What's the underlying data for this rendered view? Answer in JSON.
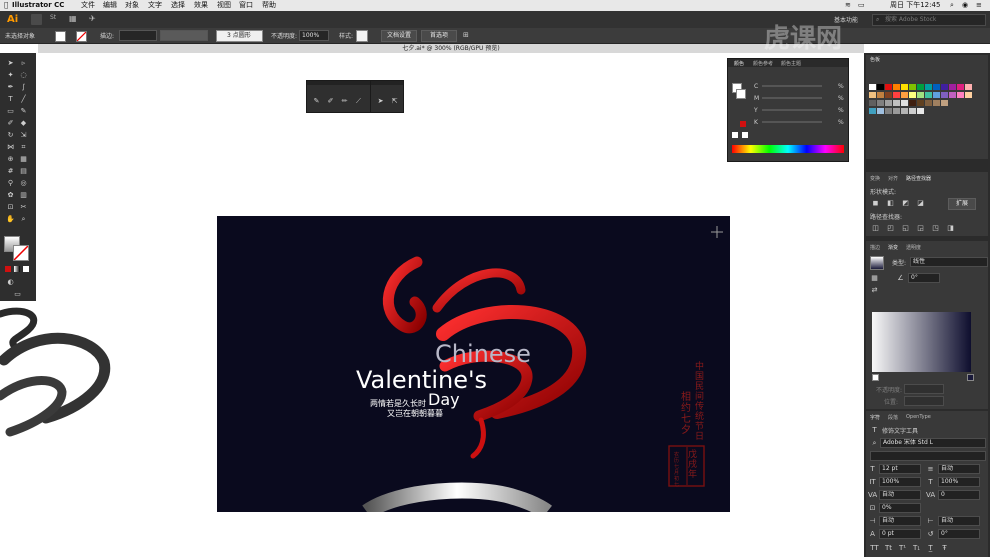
{
  "menubar": {
    "app_name": "Illustrator CC",
    "menus": [
      "文件",
      "编辑",
      "对象",
      "文字",
      "选择",
      "效果",
      "视图",
      "窗口",
      "帮助"
    ],
    "clock": "周日 下午12:45"
  },
  "appbar": {
    "logo": "Ai",
    "br": "Br",
    "st": "St",
    "workspace": "基本功能",
    "search_placeholder": "搜索 Adobe Stock"
  },
  "control_bar": {
    "selection_status": "未选择对象",
    "stroke_label": "描边:",
    "brush_label": "3 点圆形",
    "opacity_label": "不透明度:",
    "opacity_value": "100%",
    "style_label": "样式:",
    "doc_setup": "文档设置",
    "preferences": "首选项"
  },
  "document_tab": {
    "title": "七夕.ai* @ 300% (RGB/GPU 预览)"
  },
  "color_panel": {
    "tabs": [
      "颜色",
      "颜色参考",
      "颜色主题"
    ],
    "channels": [
      "C",
      "M",
      "Y",
      "K"
    ],
    "unit": "%"
  },
  "right_dock": {
    "swatches_tab": "色板",
    "tabs_row1": [
      "变换",
      "对齐",
      "路径查找器"
    ],
    "shape_modes_label": "形状模式:",
    "expand_button": "扩展",
    "pathfinder_label": "路径查找器:",
    "tabs_row2": [
      "描边",
      "渐变",
      "透明度"
    ],
    "type_label": "类型:",
    "type_value": "线性",
    "angle_value": "0°",
    "gradient_opacity_label": "不透明度:",
    "gradient_location_label": "位置:",
    "tabs_row3": [
      "字符",
      "段落",
      "OpenType"
    ],
    "touch_type": "修饰文字工具",
    "font_family": "Adobe 宋体 Std L",
    "font_size": "12 pt",
    "leading": "自动",
    "vscale": "100%",
    "hscale": "100%",
    "kerning": "自动",
    "tracking": "0",
    "tsume": "0%",
    "aki_left": "自动",
    "aki_right": "自动",
    "baseline": "0 pt",
    "rotation": "0°"
  },
  "artwork": {
    "chinese": "Chinese",
    "valentines": "Valentine's",
    "day": "Day",
    "poem_line1": "两情若是久长时",
    "poem_line2": "又岂在朝朝暮暮",
    "vertical1": "中国民间传统节日",
    "vertical2": "相约七夕",
    "seal_text": "戊戌年",
    "seal_small": "农历七月初七",
    "brand_colors": {
      "bg": "#0a0a1e",
      "red": "#e01010"
    }
  },
  "watermark": {
    "text": "虎课网"
  }
}
